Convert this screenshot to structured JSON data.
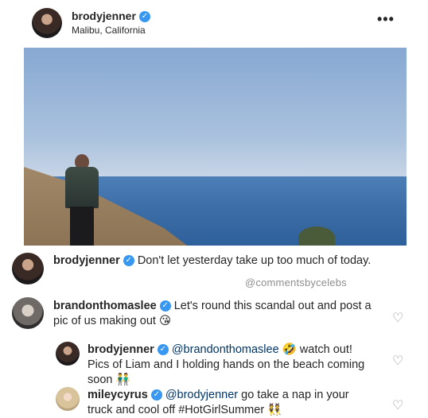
{
  "post": {
    "username": "brodyjenner",
    "location": "Malibu, California",
    "more_icon": "•••"
  },
  "caption": {
    "username": "brodyjenner",
    "text": " Don't let yesterday take up too much of today."
  },
  "watermark": "@commentsbycelebs",
  "comments": [
    {
      "username": "brandonthomaslee",
      "text": " Let's round this scandal out and post a pic of us making out 😘"
    },
    {
      "username": "brodyjenner",
      "mention": "@brandonthomaslee",
      "text": " 🤣 watch out! Pics of Liam and I holding hands on the beach coming soon 👬"
    },
    {
      "username": "mileycyrus",
      "mention": "@brodyjenner",
      "text": " go take a nap in your truck and cool off #HotGirlSummer 👯"
    }
  ],
  "icons": {
    "verified": "✓",
    "heart": "♡"
  }
}
